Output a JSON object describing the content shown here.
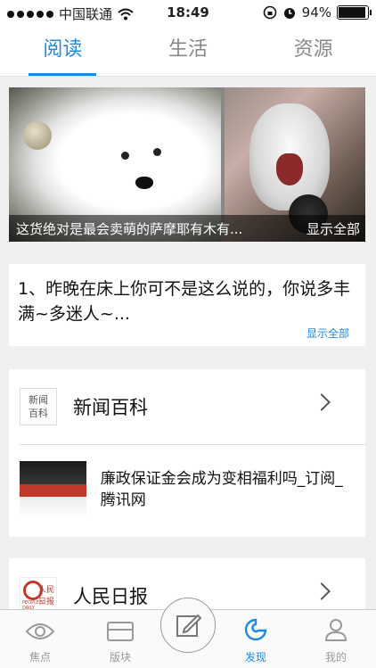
{
  "status_bar": {
    "carrier": "中国联通",
    "time": "18:49",
    "battery": "94%",
    "battery_level": 0.94
  },
  "tabs": [
    {
      "label": "阅读",
      "active": true
    },
    {
      "label": "生活",
      "active": false
    },
    {
      "label": "资源",
      "active": false
    }
  ],
  "photo_card": {
    "caption": "这货绝对是最会卖萌的萨摩耶有木有...",
    "show_all": "显示全部"
  },
  "text_card": {
    "body": "1、昨晚在床上你可不是这么说的，你说多丰满~多迷人~...",
    "show_all": "显示全部"
  },
  "news_card": {
    "channel": "新闻百科",
    "logo_text": "新闻百科",
    "article_title": "廉政保证金会成为变相福利吗_订阅_腾讯网"
  },
  "rmrb_card": {
    "channel": "人民日报"
  },
  "bottom_nav": [
    {
      "label": "焦点",
      "icon": "eye-icon",
      "active": false
    },
    {
      "label": "版块",
      "icon": "card-icon",
      "active": false
    },
    {
      "label": "发现",
      "icon": "discover-icon",
      "active": true
    },
    {
      "label": "我的",
      "icon": "person-icon",
      "active": false
    }
  ],
  "colors": {
    "accent": "#1e88e5",
    "background": "#f0f0f0"
  }
}
